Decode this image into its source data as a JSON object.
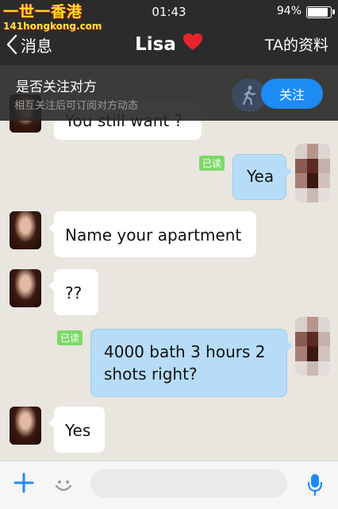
{
  "watermark": {
    "main": "一世一香港",
    "sub": "141hongkong.com"
  },
  "status_bar": {
    "time": "01:43",
    "battery": "94%",
    "battery_level": 0.94
  },
  "nav": {
    "back_label": "消息",
    "title": "Lisa",
    "title_icon": "heart-icon",
    "profile_link": "TA的资料"
  },
  "follow_banner": {
    "question": "是否关注对方",
    "subtitle": "相互关注后可订阅对方动态",
    "button_label": "关注",
    "icon": "walking-person-icon"
  },
  "messages": [
    {
      "side": "left",
      "text": "You still want ?",
      "partial": true
    },
    {
      "side": "right",
      "text": "Yea",
      "read": "已读"
    },
    {
      "side": "left",
      "text": "Name your apartment"
    },
    {
      "side": "left",
      "text": "??"
    },
    {
      "side": "right",
      "text": "4000 bath 3 hours 2 shots right?",
      "read": "已读"
    },
    {
      "side": "left",
      "text": "Yes"
    }
  ],
  "input_bar": {
    "plus_icon": "plus-icon",
    "emoji_icon": "smiley-icon",
    "mic_icon": "microphone-icon",
    "placeholder": ""
  },
  "colors": {
    "accent": "#1d8bf4",
    "bar_bg": "#2b2b2b",
    "chat_bg": "#e9e6df",
    "my_bubble": "#b6dcf8",
    "read_badge": "#7ed96a",
    "heart": "#e8232b"
  }
}
